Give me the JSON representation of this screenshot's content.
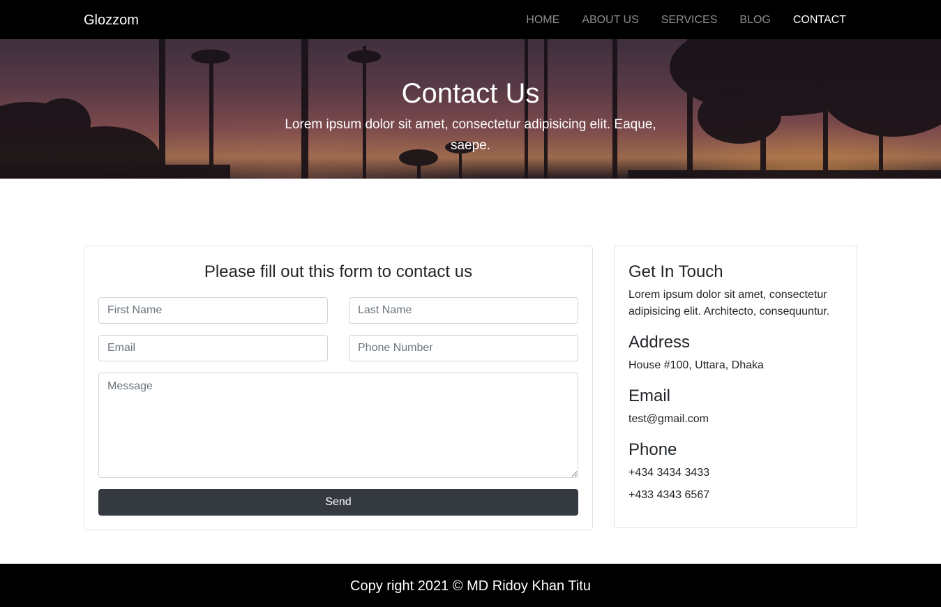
{
  "navbar": {
    "brand": "Glozzom",
    "links": [
      {
        "label": "HOME",
        "active": false
      },
      {
        "label": "ABOUT US",
        "active": false
      },
      {
        "label": "SERVICES",
        "active": false
      },
      {
        "label": "BLOG",
        "active": false
      },
      {
        "label": "CONTACT",
        "active": true
      }
    ]
  },
  "hero": {
    "title": "Contact Us",
    "subtitle": "Lorem ipsum dolor sit amet, consectetur adipisicing elit. Eaque, saepe."
  },
  "form": {
    "title": "Please fill out this form to contact us",
    "first_name_placeholder": "First Name",
    "last_name_placeholder": "Last Name",
    "email_placeholder": "Email",
    "phone_placeholder": "Phone Number",
    "message_placeholder": "Message",
    "send_label": "Send"
  },
  "info": {
    "touch_heading": "Get In Touch",
    "touch_text": "Lorem ipsum dolor sit amet, consectetur adipisicing elit. Architecto, consequuntur.",
    "address_heading": "Address",
    "address_text": "House #100, Uttara, Dhaka",
    "email_heading": "Email",
    "email_text": "test@gmail.com",
    "phone_heading": "Phone",
    "phone_1": "+434 3434 3433",
    "phone_2": "+433 4343 6567"
  },
  "footer": {
    "text": "Copy right 2021 © MD Ridoy Khan Titu"
  },
  "colors": {
    "navbar_bg": "#000000",
    "button_bg": "#343a40",
    "footer_bg": "#000000"
  }
}
